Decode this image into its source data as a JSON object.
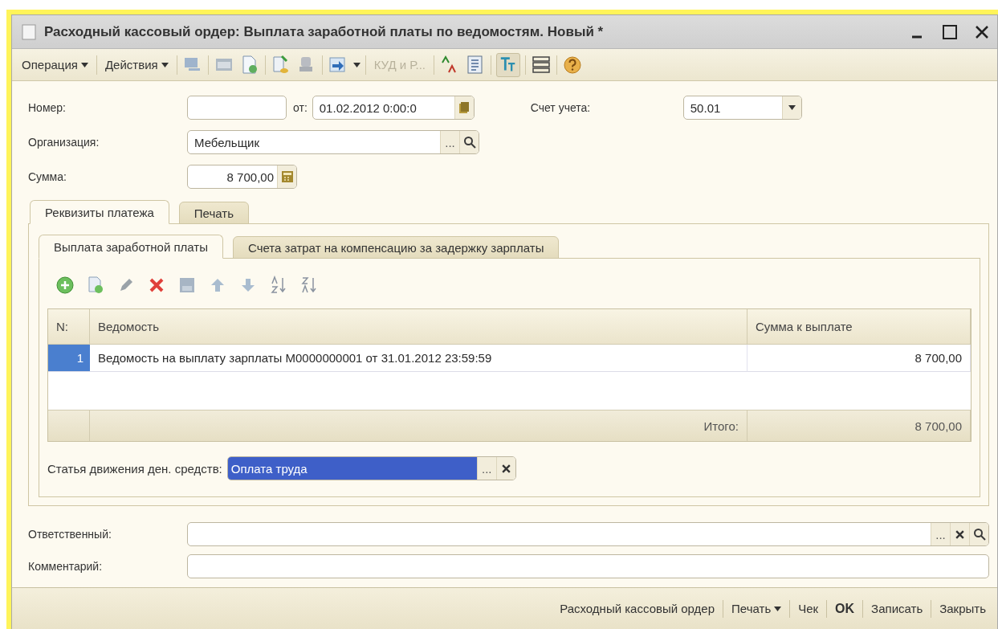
{
  "window": {
    "title": "Расходный кассовый ордер: Выплата заработной платы по ведомостям. Новый *"
  },
  "toolbar": {
    "menus": [
      "Операция",
      "Действия"
    ],
    "link": {
      "label": "КУД и Р...",
      "disabled": true
    }
  },
  "header": {
    "number": {
      "label": "Номер:"
    },
    "date": {
      "label": "от:",
      "value": "01.02.2012  0:00:0"
    },
    "account": {
      "label": "Счет учета:",
      "value": "50.01"
    },
    "organization": {
      "label": "Организация:",
      "value": "Мебельщик",
      "select_button": "..."
    },
    "sum": {
      "label": "Сумма:",
      "value": "8 700,00"
    }
  },
  "tabs": [
    {
      "label": "Реквизиты платежа",
      "selected": true
    },
    {
      "label": "Печать",
      "selected": false
    }
  ],
  "inner_tabs": [
    {
      "label": "Выплата заработной платы",
      "selected": true
    },
    {
      "label": "Счета затрат на компенсацию за задержку зарплаты",
      "selected": false
    }
  ],
  "table": {
    "columns": [
      "N:",
      "Ведомость",
      "Сумма к выплате"
    ],
    "rows": [
      {
        "number": "1",
        "statement": "Ведомость на выплату зарплаты М0000000001 от 31.01.2012 23:59:59",
        "amount": "8 700,00",
        "selected": true
      }
    ],
    "footer": {
      "label": "Итого:",
      "amount": "8 700,00"
    }
  },
  "cash_flow": {
    "label": "Статья движения ден. средств:",
    "value": "Оплата труда",
    "highlighted": true,
    "select_button": "..."
  },
  "responsible": {
    "label": "Ответственный:",
    "select_button": "..."
  },
  "comment": {
    "label": "Комментарий:"
  },
  "buttons": [
    {
      "label": "Расходный кассовый ордер",
      "kind": "plain"
    },
    {
      "label": "Печать",
      "kind": "menu"
    },
    {
      "label": "Чек",
      "kind": "plain"
    },
    {
      "label": "OK",
      "kind": "default"
    },
    {
      "label": "Записать",
      "kind": "plain"
    },
    {
      "label": "Закрыть",
      "kind": "plain"
    }
  ]
}
